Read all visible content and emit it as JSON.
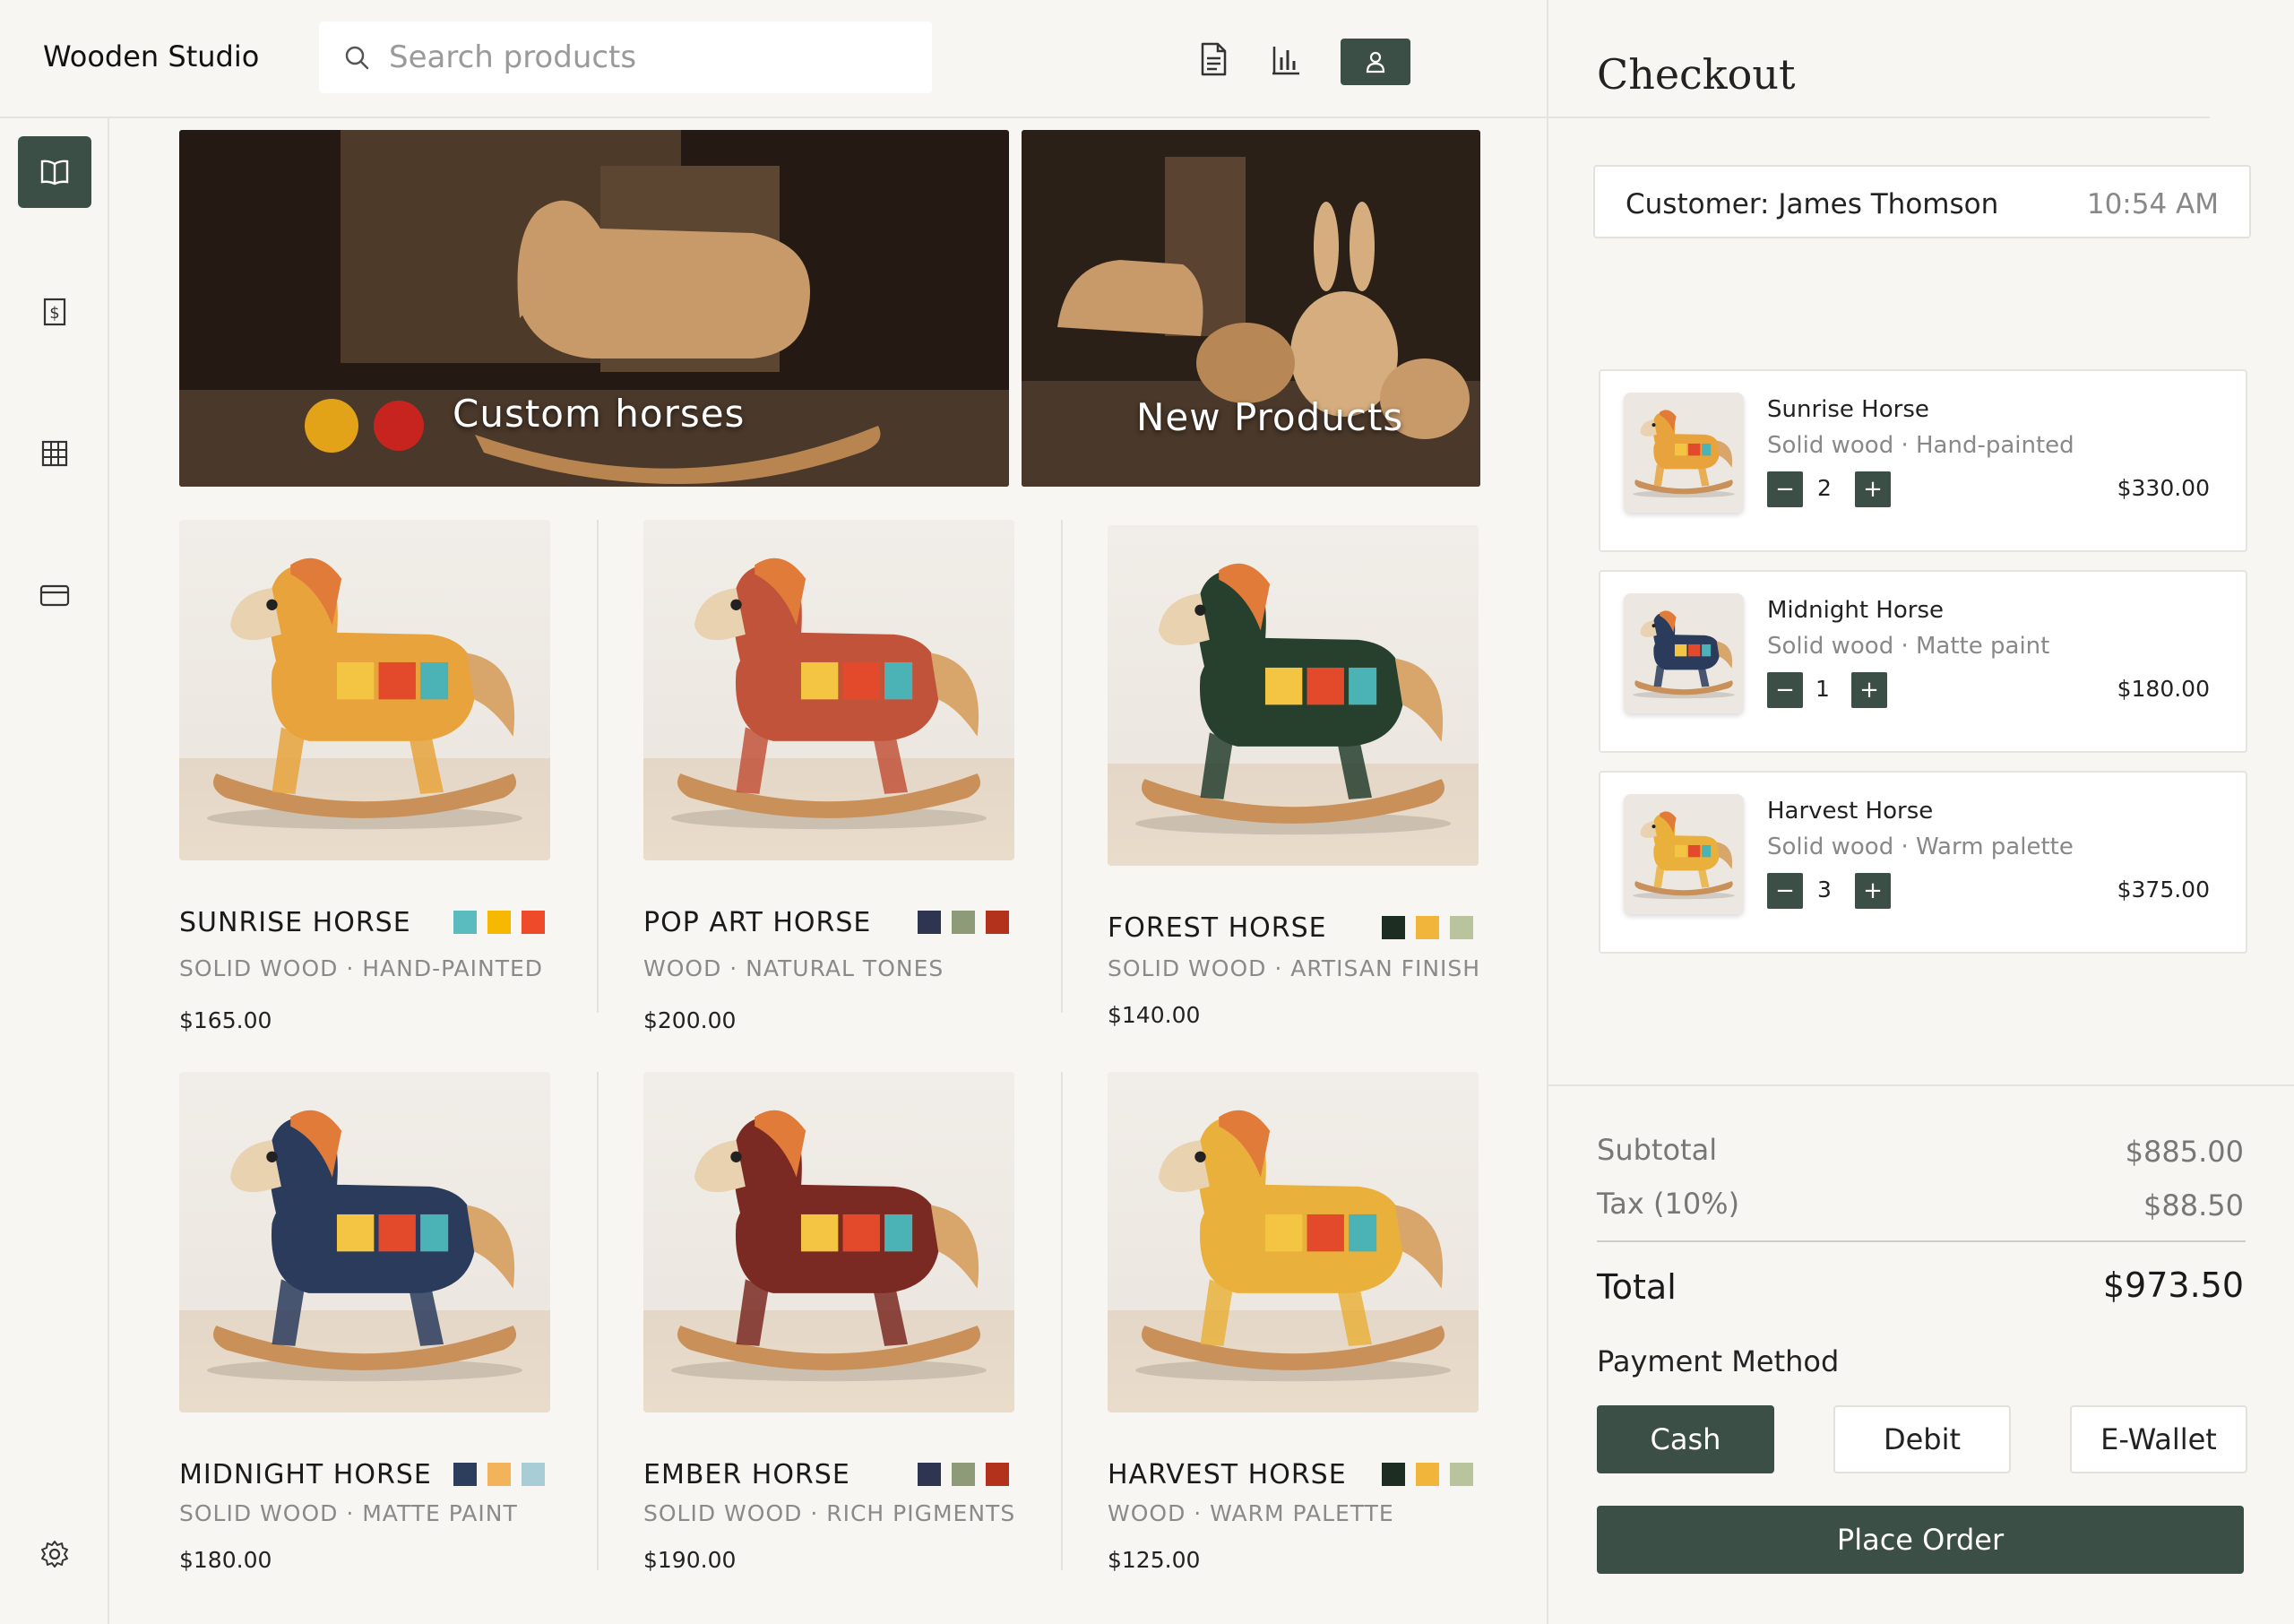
{
  "header": {
    "brand": "Wooden Studio",
    "search_placeholder": "Search products",
    "icons": [
      "document-icon",
      "bar-chart-icon",
      "user-icon"
    ]
  },
  "sidebar": {
    "items": [
      {
        "icon": "book-icon",
        "active": true
      },
      {
        "icon": "receipt-icon",
        "active": false
      },
      {
        "icon": "grid-icon",
        "active": false
      },
      {
        "icon": "card-icon",
        "active": false
      }
    ],
    "settings_icon": "gear-icon"
  },
  "banners": [
    {
      "title": "Custom horses"
    },
    {
      "title": "New Products"
    }
  ],
  "products": [
    {
      "name": "SUNRISE HORSE",
      "desc": "SOLID WOOD · HAND-PAINTED",
      "price": "$165.00",
      "swatches": [
        "#5bbcbf",
        "#f6b800",
        "#ef4a2a"
      ]
    },
    {
      "name": "POP ART HORSE",
      "desc": "WOOD · NATURAL TONES",
      "price": "$200.00",
      "swatches": [
        "#2d3550",
        "#8e9b78",
        "#b2321c"
      ]
    },
    {
      "name": "FOREST HORSE",
      "desc": "SOLID WOOD · ARTISAN FINISH",
      "price": "$140.00",
      "swatches": [
        "#1e2d22",
        "#f2b53c",
        "#b9c39c"
      ]
    },
    {
      "name": "MIDNIGHT HORSE",
      "desc": "SOLID WOOD · MATTE PAINT",
      "price": "$180.00",
      "swatches": [
        "#2d3d5c",
        "#f2b35a",
        "#a9cdd6"
      ]
    },
    {
      "name": "EMBER HORSE",
      "desc": "SOLID WOOD · RICH PIGMENTS",
      "price": "$190.00",
      "swatches": [
        "#2d3550",
        "#8e9b78",
        "#b2321c"
      ]
    },
    {
      "name": "HARVEST HORSE",
      "desc": "WOOD · WARM PALETTE",
      "price": "$125.00",
      "swatches": [
        "#1e2d22",
        "#f2b53c",
        "#b9c39c"
      ]
    }
  ],
  "checkout": {
    "title": "Checkout",
    "customer": "Customer: James Thomson",
    "time": "10:54 AM",
    "items": [
      {
        "name": "Sunrise Horse",
        "desc": "Solid wood · Hand-painted",
        "qty": "2",
        "price": "$330.00",
        "minus": "−",
        "plus": "+"
      },
      {
        "name": "Midnight Horse",
        "desc": "Solid wood · Matte paint",
        "qty": "1",
        "price": "$180.00",
        "minus": "−",
        "plus": "+"
      },
      {
        "name": "Harvest Horse",
        "desc": "Solid wood · Warm palette",
        "qty": "3",
        "price": "$375.00",
        "minus": "−",
        "plus": "+"
      }
    ],
    "subtotal_label": "Subtotal",
    "subtotal": "$885.00",
    "tax_label": "Tax (10%)",
    "tax": "$88.50",
    "total_label": "Total",
    "total": "$973.50",
    "payment_label": "Payment Method",
    "payment_methods": [
      "Cash",
      "Debit",
      "E-Wallet"
    ],
    "selected_payment": "Cash",
    "place_order": "Place Order"
  },
  "colors": {
    "accent": "#3c4f46",
    "background": "#f7f6f3"
  }
}
